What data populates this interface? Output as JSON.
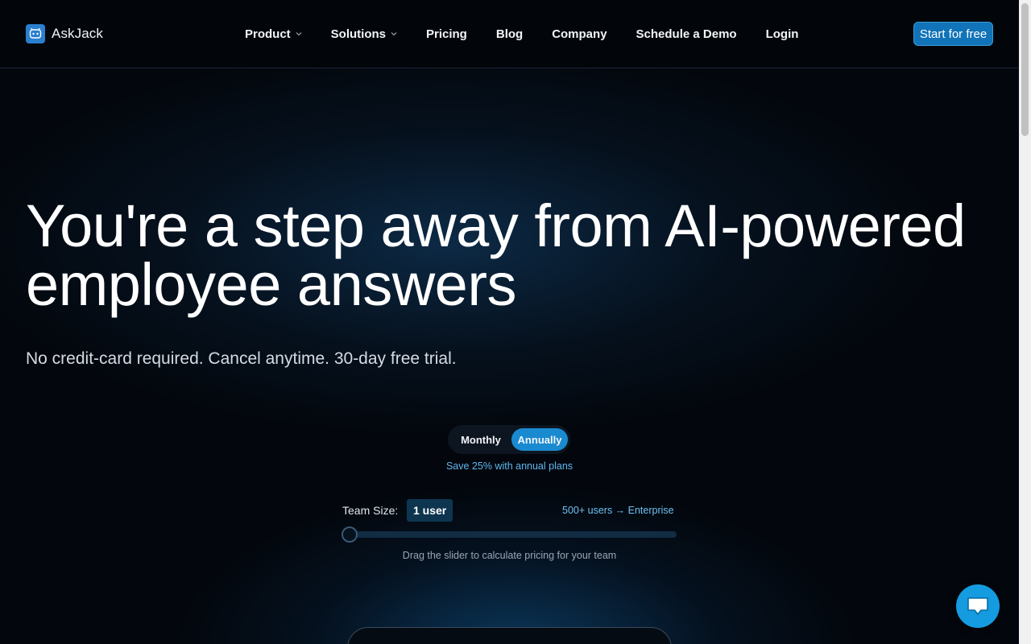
{
  "header": {
    "brand": "AskJack",
    "nav": [
      {
        "label": "Product",
        "dropdown": true
      },
      {
        "label": "Solutions",
        "dropdown": true
      },
      {
        "label": "Pricing",
        "dropdown": false
      },
      {
        "label": "Blog",
        "dropdown": false
      },
      {
        "label": "Company",
        "dropdown": false
      },
      {
        "label": "Schedule a Demo",
        "dropdown": false
      },
      {
        "label": "Login",
        "dropdown": false
      }
    ],
    "cta_label": "Start for free"
  },
  "hero": {
    "title_line1": "You're a step away from AI-powered",
    "title_line2": "employee answers",
    "subtitle": "No credit-card required. Cancel anytime. 30-day free trial."
  },
  "billing": {
    "options": [
      "Monthly",
      "Annually"
    ],
    "selected": "Annually",
    "save_note": "Save 25% with annual plans"
  },
  "team": {
    "label": "Team Size:",
    "value_label": "1 user",
    "enterprise_link": "500+ users → Enterprise",
    "slider_hint": "Drag the slider to calculate pricing for your team",
    "slider_value_fraction": 0
  },
  "icons": {
    "logo": "robot-face-icon",
    "dropdown": "chevron-down-icon",
    "chat": "chat-bubble-icon"
  },
  "colors": {
    "accent": "#1a8ad0",
    "cta": "#1173b8",
    "link": "#6ec0f2",
    "background": "#03070d"
  }
}
